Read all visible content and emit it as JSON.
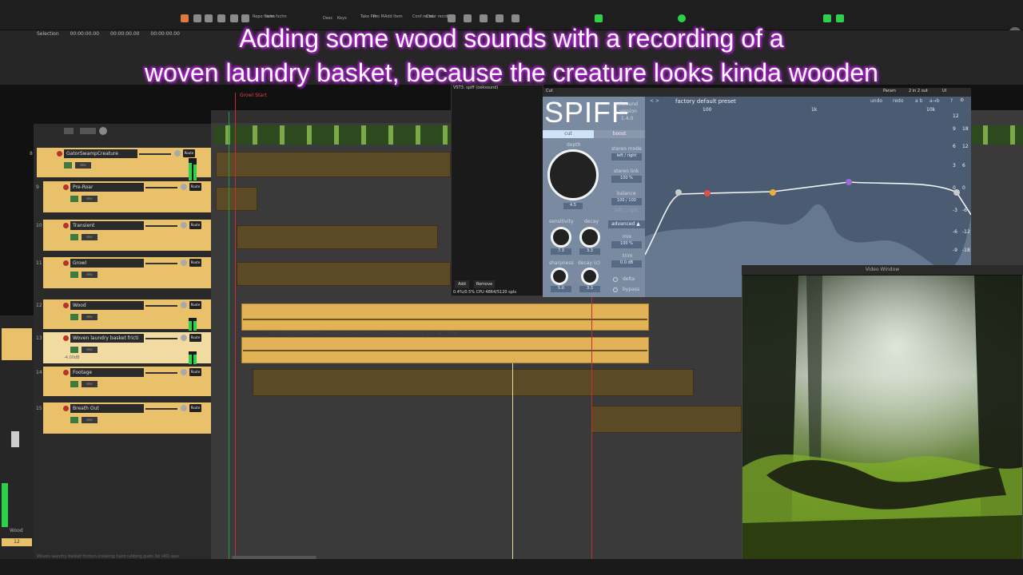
{
  "caption": {
    "line1": "Adding some wood sounds with a recording of a",
    "line2": "woven laundry basket, because the creature looks kinda wooden"
  },
  "toolbar": {
    "labels": [
      "Repo fxchn",
      "Item fxchn",
      "Desc",
      "Keys",
      "Take Pro",
      "Pro M",
      "Add Item",
      "Conf recrd",
      "Clear recrd"
    ]
  },
  "transport": {
    "selection_label": "Selection",
    "selection_values": [
      "00:00:00.00",
      "00:00:00.00",
      "00:00:00.00"
    ],
    "marker": "Growl Start"
  },
  "tracks": [
    {
      "num": "8",
      "name": "GatorSwampCreature",
      "route": "Route"
    },
    {
      "num": "9",
      "name": "Pre-Roar",
      "route": "Route"
    },
    {
      "num": "10",
      "name": "Transient",
      "route": "Route"
    },
    {
      "num": "11",
      "name": "Growl",
      "route": "Route"
    },
    {
      "num": "12",
      "name": "Wood",
      "route": "Route"
    },
    {
      "num": "13",
      "name": "Woven laundry basket fricti",
      "route": "Route",
      "extra": "-4.00dB"
    },
    {
      "num": "14",
      "name": "Footage",
      "route": "Route"
    },
    {
      "num": "15",
      "name": "Breath Out",
      "route": "Route"
    }
  ],
  "fx_window": {
    "title": "VST3: spiff (oeksound)",
    "add_button": "Add",
    "remove_button": "Remove",
    "cpu": "0.4%/0.5% CPU 4864/5120 spls"
  },
  "spiff": {
    "header_tab": "Cut",
    "header_right": [
      "Param",
      "2 in 2 out",
      "UI"
    ],
    "logo": "SPIFF",
    "vendor": "oeksound",
    "version_label": "version",
    "version": "1.4.0",
    "preset_nav": "< >",
    "preset_name": "factory default preset",
    "undo": "undo",
    "redo": "redo",
    "ab": "a b",
    "a_to_b": "a→b",
    "help": "?",
    "tabs": [
      "cut",
      "boost"
    ],
    "depth_label": "depth",
    "depth_value": "4.5",
    "stereo_mode_label": "stereo mode",
    "stereo_mode_value": "left / right",
    "stereo_link_label": "stereo link",
    "stereo_link_value": "100 %",
    "balance_label": "balance",
    "balance_value": "100 / 100",
    "balance_sub": "left / right",
    "sensitivity_label": "sensitivity",
    "sensitivity_value": "7.3",
    "decay_label": "decay",
    "decay_value": "3.3",
    "sharpness_label": "sharpness",
    "sharpness_value": "5.0",
    "decay2_label": "decay (c)",
    "decay2_value": "3.3",
    "advanced": "advanced ▲",
    "mix_label": "mix",
    "mix_value": "100 %",
    "trim_label": "trim",
    "trim_value": "0.0 dB",
    "delta": "delta",
    "bypass": "bypass",
    "freq_labels": [
      "100",
      "1k",
      "10k"
    ],
    "db_left": [
      "12",
      "9",
      "6",
      "3",
      "0",
      "-3",
      "-6",
      "-9"
    ],
    "db_right": [
      "18",
      "12",
      "6",
      "0",
      "-6",
      "-12",
      "-18"
    ]
  },
  "video": {
    "title": "Video Window"
  },
  "mixer": {
    "track_name": "Wood",
    "number": "12"
  },
  "item_labels": {
    "wood_take": "Ifree 0.85 ] 000 WOODFlt Woven laundry basket friction creaking hard rubbing jpam 3d_16DHB"
  },
  "status": {
    "text": "Woven laundry basket friction creaking hard rubbing jpam 3d (4D).wav"
  },
  "colors": {
    "track_gold": "#e9c16a",
    "spiff_blue": "#5f7690",
    "caption_glow": "#b026d0",
    "meter_green": "#2fd14a"
  }
}
